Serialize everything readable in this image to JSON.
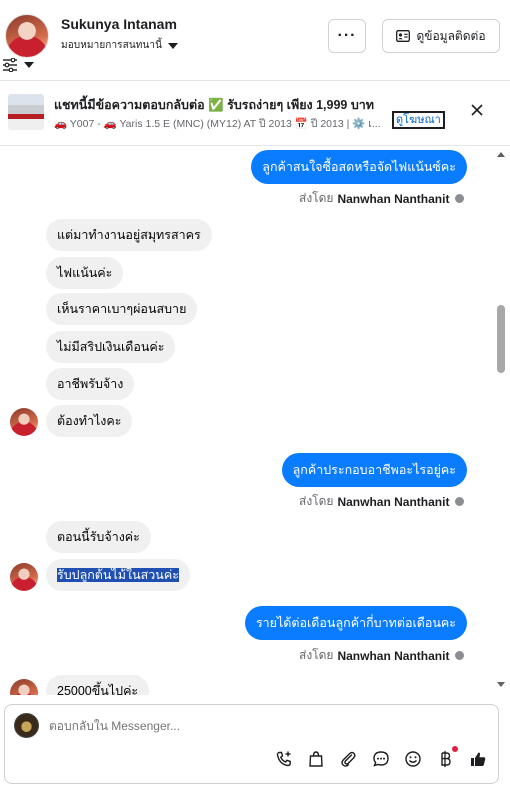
{
  "header": {
    "contact_name": "Sukunya Intanam",
    "assign_label": "มอบหมายการสนทนานี้",
    "more_label": "···",
    "contact_info_label": "ดูข้อมูลติดต่อ"
  },
  "banner": {
    "title": "แชทนี้มีข้อความตอบกลับต่อ ✅ รับรถง่ายๆ เพียง 1,999 บาท",
    "subtitle": "🚗 Y007 - 🚗 Yaris 1.5 E (MNC) (MY12) AT ปี 2013 📅 ปี 2013 | ⚙️ เ...",
    "link_label": "ดูโฆษณา"
  },
  "messages": {
    "m1": "ลูกค้าสนใจซื้อสดหรือจัดไฟแน้นซ์คะ",
    "sent_by_prefix": "ส่งโดย",
    "agent_name": "Nanwhan Nanthanit",
    "m2": "แต่มาทำงานอยู่สมุทรสาคร",
    "m3": "ไฟแน้นค่ะ",
    "m4": "เห็นราคาเบาๆผ่อนสบาย",
    "m5": "ไม่มีสริปเงินเดือนค่ะ",
    "m6": "อาชีพรับจ้าง",
    "m7": "ต้องทำไงคะ",
    "m8": "ลูกค้าประกอบอาชีพอะไรอยู่คะ",
    "m9": "ตอนนี้รับจ้างค่ะ",
    "m10": "รับปลูกต้นไม้ในสวนค่ะ",
    "m11": "รายได้ต่อเดือนลูกค้ากี่บาทต่อเดือนคะ",
    "m12": "25000ขึ้นไปค่ะ"
  },
  "composer": {
    "placeholder": "ตอบกลับใน Messenger..."
  },
  "colors": {
    "outgoing_bubble": "#0a7cff",
    "incoming_bubble": "#f0f0f0",
    "link": "#0064d1",
    "notification_dot": "#e41e3f",
    "thumbs_up": "#1c1e21"
  },
  "icons": {
    "filter": "sliders-icon",
    "contact_card": "id-card-icon",
    "close": "close-icon",
    "info": "info-icon",
    "call_add": "phone-plus-icon",
    "bag": "shopping-bag-icon",
    "attach": "paperclip-icon",
    "saved_reply": "chat-bubble-icon",
    "emoji": "smiley-icon",
    "currency": "baht-icon",
    "like": "thumbs-up-icon"
  }
}
